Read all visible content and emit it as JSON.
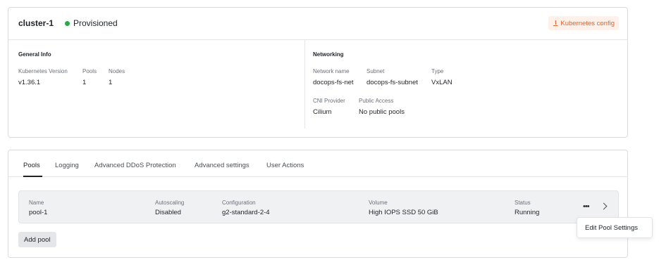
{
  "cluster": {
    "name": "cluster-1",
    "status": "Provisioned",
    "status_color": "#2aa84a",
    "kube_config_label": "Kubernetes config",
    "kube_config_icon": "download-icon"
  },
  "general_info": {
    "title": "General Info",
    "fields": [
      {
        "label": "Kubernetes Version",
        "value": "v1.36.1"
      },
      {
        "label": "Pools",
        "value": "1"
      },
      {
        "label": "Nodes",
        "value": "1"
      }
    ]
  },
  "networking": {
    "title": "Networking",
    "fields": [
      {
        "label": "Network name",
        "value": "docops-fs-net"
      },
      {
        "label": "Subnet",
        "value": "docops-fs-subnet"
      },
      {
        "label": "Type",
        "value": "VxLAN"
      },
      {
        "label": "CNI Provider",
        "value": "Cilium"
      },
      {
        "label": "Public Access",
        "value": "No public pools"
      }
    ]
  },
  "tabs": [
    {
      "label": "Pools",
      "active": true
    },
    {
      "label": "Logging",
      "active": false
    },
    {
      "label": "Advanced DDoS Protection",
      "active": false
    },
    {
      "label": "Advanced settings",
      "active": false
    },
    {
      "label": "User Actions",
      "active": false
    }
  ],
  "pool": {
    "columns": [
      {
        "label": "Name",
        "value": "pool-1"
      },
      {
        "label": "Autoscaling",
        "value": "Disabled"
      },
      {
        "label": "Configuration",
        "value": "g2-standard-2-4"
      },
      {
        "label": "Volume",
        "value": "High IOPS SSD 50 GiB"
      },
      {
        "label": "Status",
        "value": "Running"
      }
    ],
    "more_icon": "more-horizontal-icon",
    "expand_icon": "chevron-right-icon"
  },
  "add_pool_label": "Add pool",
  "menu": {
    "items": [
      "Edit Pool Settings"
    ]
  },
  "colors": {
    "accent": "#e0622a",
    "accent_bg": "#fff1ea",
    "border": "#d9dbdf"
  }
}
